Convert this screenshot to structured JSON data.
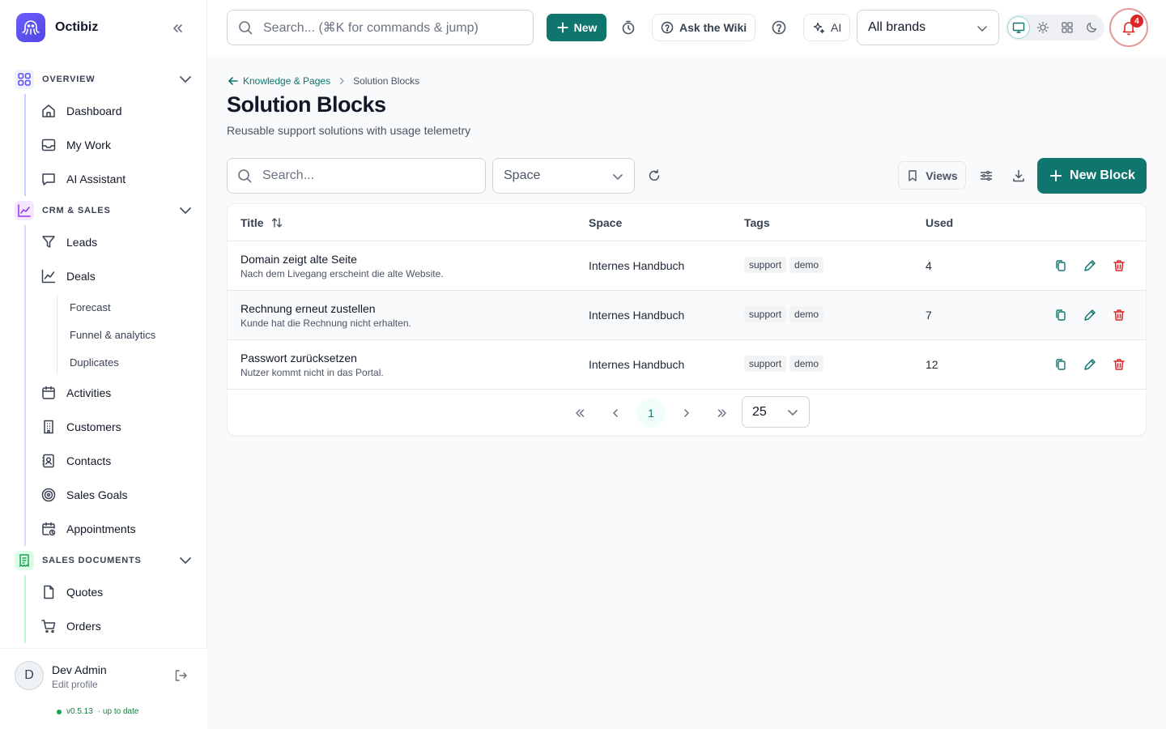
{
  "app": {
    "name": "Octibiz"
  },
  "sidebar": {
    "sections": [
      {
        "label": "OVERVIEW",
        "items": [
          "Dashboard",
          "My Work",
          "AI Assistant"
        ]
      },
      {
        "label": "CRM & SALES",
        "items": [
          "Leads",
          "Deals",
          "Activities",
          "Customers",
          "Contacts",
          "Sales Goals",
          "Appointments"
        ],
        "deals_subitems": [
          "Forecast",
          "Funnel & analytics",
          "Duplicates"
        ]
      },
      {
        "label": "SALES DOCUMENTS",
        "items": [
          "Quotes",
          "Orders"
        ]
      }
    ],
    "user": {
      "initial": "D",
      "name": "Dev Admin",
      "sub": "Edit profile"
    },
    "version": {
      "label": "v0.5.13",
      "status": "· up to date"
    }
  },
  "topbar": {
    "search_placeholder": "Search... (⌘K for commands & jump)",
    "new_label": "New",
    "wiki_label": "Ask the Wiki",
    "ai_label": "AI",
    "brand_select": "All brands",
    "notification_count": "4"
  },
  "page": {
    "breadcrumb_parent": "Knowledge & Pages",
    "breadcrumb_current": "Solution Blocks",
    "title": "Solution Blocks",
    "subtitle": "Reusable support solutions with usage telemetry"
  },
  "toolbar": {
    "search_placeholder": "Search...",
    "space_placeholder": "Space",
    "views_label": "Views",
    "new_block_label": "New Block"
  },
  "table": {
    "headers": {
      "title": "Title",
      "space": "Space",
      "tags": "Tags",
      "used": "Used"
    },
    "rows": [
      {
        "title": "Domain zeigt alte Seite",
        "desc": "Nach dem Livegang erscheint die alte Website.",
        "space": "Internes Handbuch",
        "tags": [
          "support",
          "demo"
        ],
        "used": "4"
      },
      {
        "title": "Rechnung erneut zustellen",
        "desc": "Kunde hat die Rechnung nicht erhalten.",
        "space": "Internes Handbuch",
        "tags": [
          "support",
          "demo"
        ],
        "used": "7"
      },
      {
        "title": "Passwort zurücksetzen",
        "desc": "Nutzer kommt nicht in das Portal.",
        "space": "Internes Handbuch",
        "tags": [
          "support",
          "demo"
        ],
        "used": "12"
      }
    ]
  },
  "pagination": {
    "current_page": "1",
    "page_size": "25"
  },
  "colors": {
    "accent": "#0f766e",
    "danger": "#dc2626",
    "brand": "#5b4cf5"
  }
}
